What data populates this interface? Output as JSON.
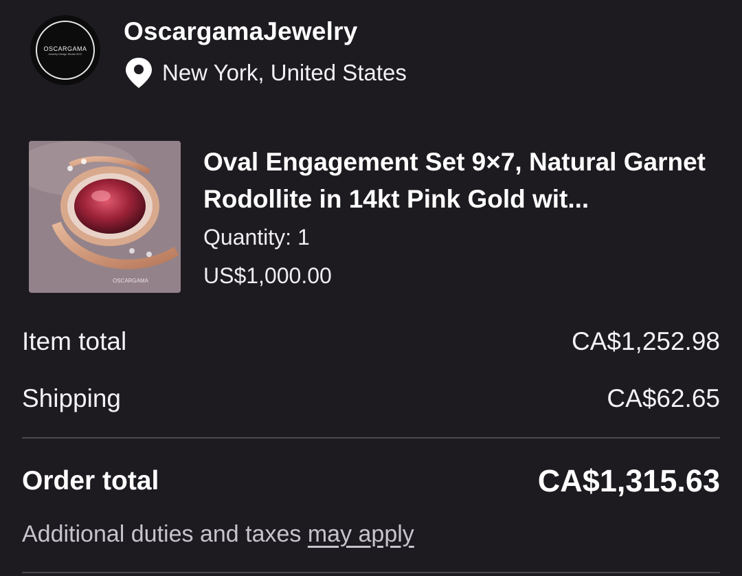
{
  "shop": {
    "logo_text": "OSCARGAMA",
    "logo_subtext": "Jewelry Design Studio NYC",
    "name": "OscargamaJewelry",
    "location_icon": "location-pin-icon",
    "location": "New York, United States"
  },
  "product": {
    "title": "Oval Engagement Set  9×7, Natural Garnet Rodollite in 14kt Pink Gold wit...",
    "quantity": "Quantity: 1",
    "price": "US$1,000.00",
    "image_watermark": "OSCARGAMA"
  },
  "summary": {
    "item_total_label": "Item total",
    "item_total_value": "CA$1,252.98",
    "shipping_label": "Shipping",
    "shipping_value": "CA$62.65",
    "order_total_label": "Order total",
    "order_total_value": "CA$1,315.63"
  },
  "duties": {
    "text": "Additional duties and taxes ",
    "link": "may apply"
  },
  "colors": {
    "background": "#1d1b20",
    "text": "#f4f2f6",
    "muted_text": "#c7c4cc",
    "divider": "#4a474e"
  }
}
